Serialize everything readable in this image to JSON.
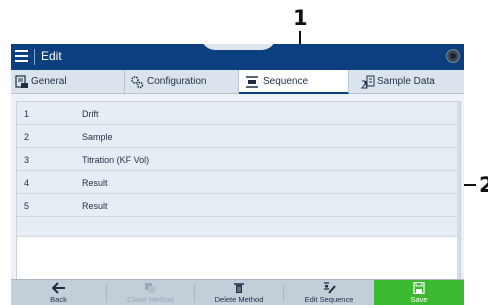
{
  "callouts": {
    "first": "1",
    "second": "2"
  },
  "header": {
    "title": "Edit"
  },
  "tabs": [
    {
      "label": "General",
      "icon": "general-icon"
    },
    {
      "label": "Configuration",
      "icon": "configuration-gears-icon"
    },
    {
      "label": "Sequence",
      "icon": "sequence-icon",
      "active": true
    },
    {
      "label": "Sample Data",
      "icon": "sample-data-icon"
    }
  ],
  "sequence": [
    {
      "number": "1",
      "name": "Drift"
    },
    {
      "number": "2",
      "name": "Sample"
    },
    {
      "number": "3",
      "name": "Titration (KF Vol)"
    },
    {
      "number": "4",
      "name": "Result"
    },
    {
      "number": "5",
      "name": "Result"
    }
  ],
  "footer": {
    "back": "Back",
    "clone_method": "Clone Method",
    "delete_method": "Delete Method",
    "edit_sequence": "Edit Sequence",
    "save": "Save"
  },
  "colors": {
    "header": "#0b3f80",
    "save_button": "#3cba2f"
  }
}
